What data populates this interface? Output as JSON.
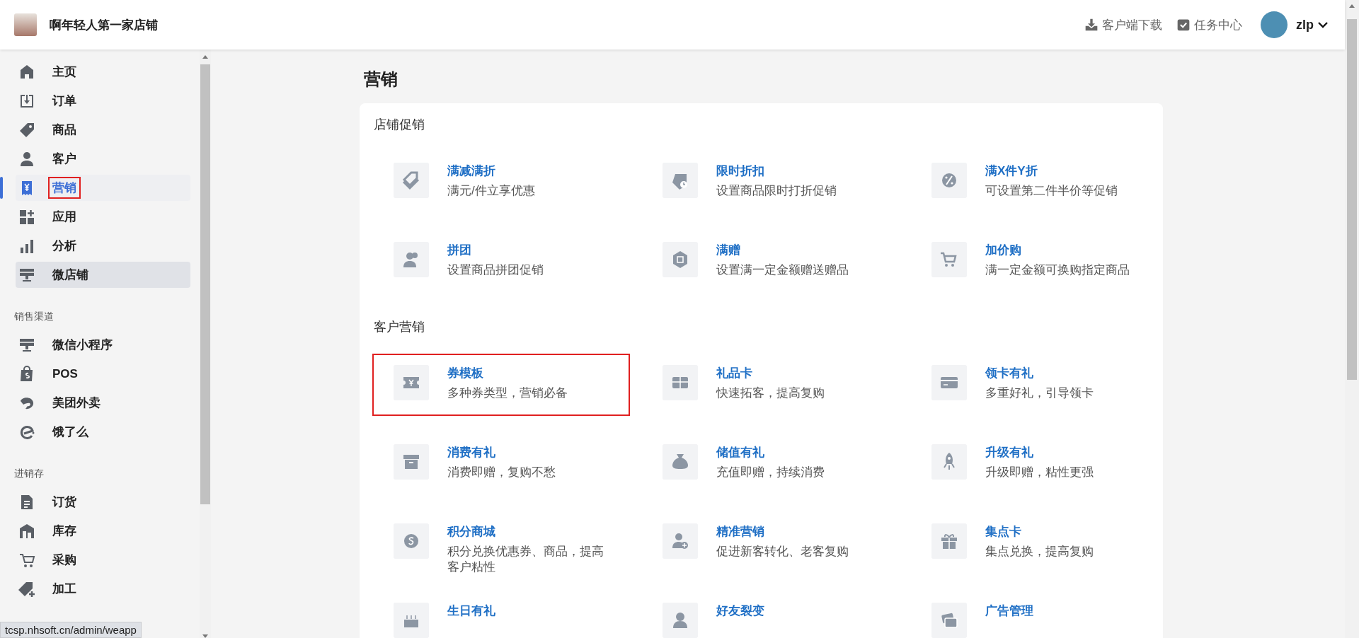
{
  "header": {
    "store_name": "啊年轻人第一家店铺",
    "actions": [
      "客户端下载",
      "任务中心"
    ],
    "user": "zlp"
  },
  "sidebar": {
    "groups": [
      {
        "items": [
          {
            "label": "主页",
            "selected": false,
            "hovered": false,
            "annotated": false
          },
          {
            "label": "订单",
            "selected": false,
            "hovered": false,
            "annotated": false
          },
          {
            "label": "商品",
            "selected": false,
            "hovered": false,
            "annotated": false
          },
          {
            "label": "客户",
            "selected": false,
            "hovered": false,
            "annotated": false
          },
          {
            "label": "营销",
            "selected": true,
            "hovered": false,
            "annotated": true
          },
          {
            "label": "应用",
            "selected": false,
            "hovered": false,
            "annotated": false
          },
          {
            "label": "分析",
            "selected": false,
            "hovered": false,
            "annotated": false
          },
          {
            "label": "微店铺",
            "selected": false,
            "hovered": true,
            "annotated": false
          }
        ]
      },
      {
        "title": "销售渠道",
        "items": [
          {
            "label": "微信小程序",
            "selected": false,
            "hovered": false,
            "annotated": false
          },
          {
            "label": "POS",
            "selected": false,
            "hovered": false,
            "annotated": false
          },
          {
            "label": "美团外卖",
            "selected": false,
            "hovered": false,
            "annotated": false
          },
          {
            "label": "饿了么",
            "selected": false,
            "hovered": false,
            "annotated": false
          }
        ]
      },
      {
        "title": "进销存",
        "items": [
          {
            "label": "订货",
            "selected": false,
            "hovered": false,
            "annotated": false
          },
          {
            "label": "库存",
            "selected": false,
            "hovered": false,
            "annotated": false
          },
          {
            "label": "采购",
            "selected": false,
            "hovered": false,
            "annotated": false
          },
          {
            "label": "加工",
            "selected": false,
            "hovered": false,
            "annotated": false
          }
        ]
      }
    ]
  },
  "status_url": "tcsp.nhsoft.cn/admin/weapp",
  "page_title": "营销",
  "sections": [
    {
      "title": "店铺促销",
      "items": [
        {
          "title": "满减满折",
          "description": "满元/件立享优惠",
          "annotated": false
        },
        {
          "title": "限时折扣",
          "description": "设置商品限时打折促销",
          "annotated": false
        },
        {
          "title": "满X件Y折",
          "description": "可设置第二件半价等促销",
          "annotated": false
        },
        {
          "title": "拼团",
          "description": "设置商品拼团促销",
          "annotated": false
        },
        {
          "title": "满赠",
          "description": "设置满一定金额赠送赠品",
          "annotated": false
        },
        {
          "title": "加价购",
          "description": "满一定金额可换购指定商品",
          "annotated": false
        }
      ]
    },
    {
      "title": "客户营销",
      "items": [
        {
          "title": "券模板",
          "description": "多种券类型，营销必备",
          "annotated": true
        },
        {
          "title": "礼品卡",
          "description": "快速拓客，提高复购",
          "annotated": false
        },
        {
          "title": "领卡有礼",
          "description": "多重好礼，引导领卡",
          "annotated": false
        },
        {
          "title": "消费有礼",
          "description": "消费即赠，复购不愁",
          "annotated": false
        },
        {
          "title": "储值有礼",
          "description": "充值即赠，持续消费",
          "annotated": false
        },
        {
          "title": "升级有礼",
          "description": "升级即赠，粘性更强",
          "annotated": false
        },
        {
          "title": "积分商城",
          "description": "积分兑换优惠券、商品，提高客户粘性",
          "annotated": false
        },
        {
          "title": "精准营销",
          "description": "促进新客转化、老客复购",
          "annotated": false
        },
        {
          "title": "集点卡",
          "description": "集点兑换，提高复购",
          "annotated": false
        },
        {
          "title": "生日有礼",
          "annotated": false
        },
        {
          "title": "好友裂变",
          "annotated": false
        },
        {
          "title": "广告管理",
          "annotated": false
        }
      ]
    }
  ]
}
